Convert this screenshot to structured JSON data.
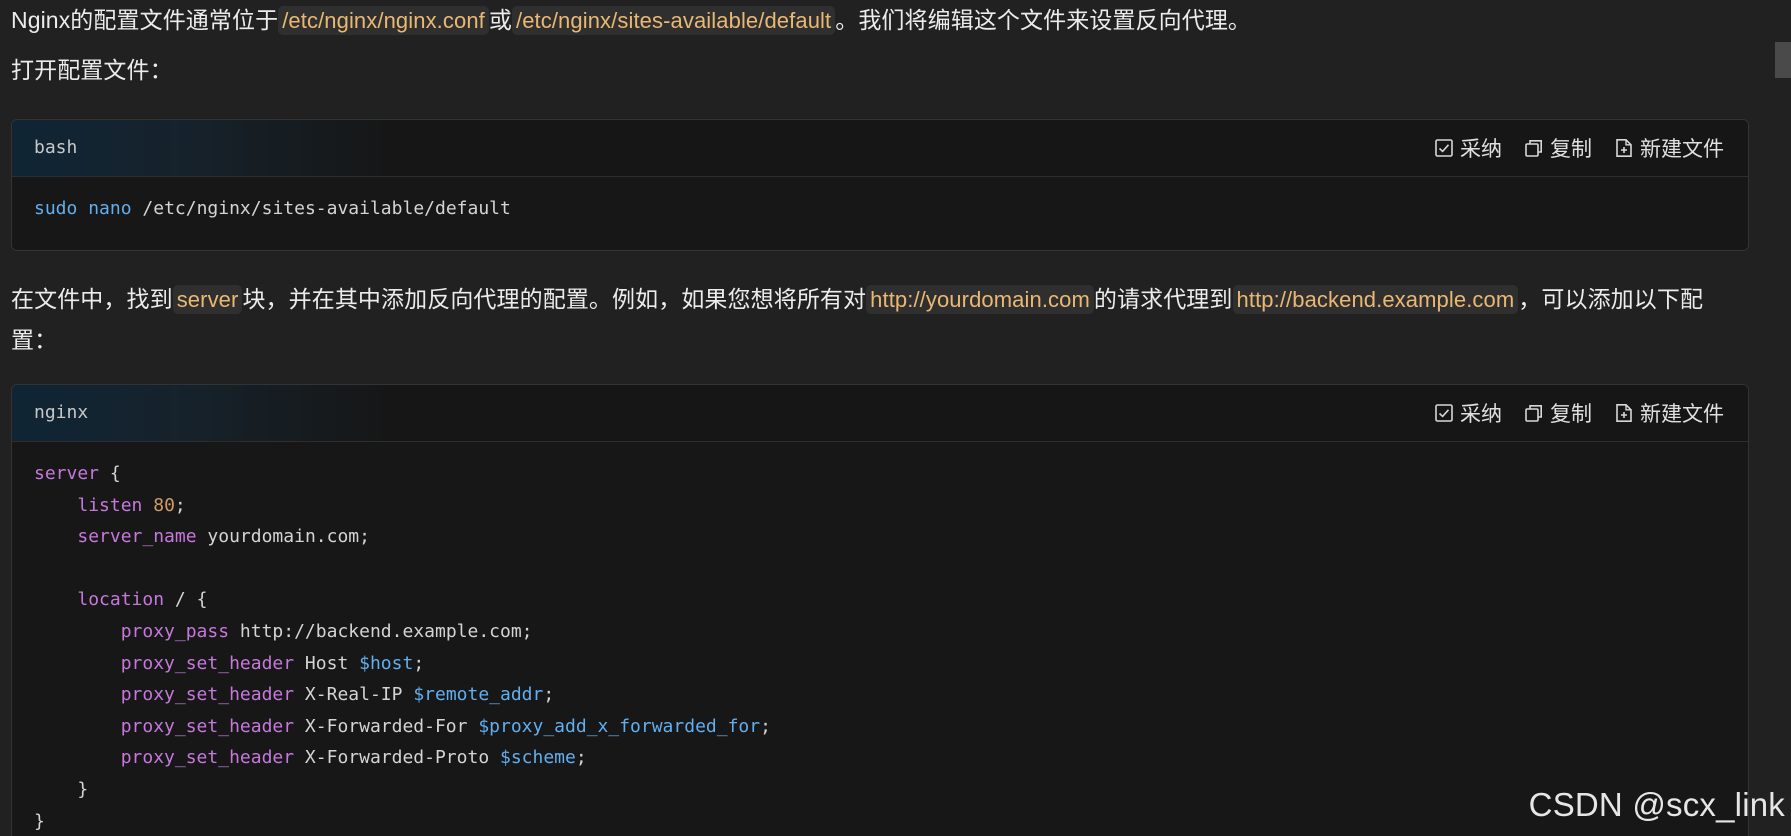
{
  "article": {
    "para1": {
      "t1": "Nginx的配置文件通常位于",
      "c1": "/etc/nginx/nginx.conf",
      "t2": "或",
      "c2": "/etc/nginx/sites-available/default",
      "t3": "。我们将编辑这个文件来设置反向代理。"
    },
    "para2": "打开配置文件：",
    "para3": {
      "t1": "在文件中，找到",
      "c1": "server",
      "t2": "块，并在其中添加反向代理的配置。例如，如果您想将所有对",
      "c2": "http://yourdomain.com",
      "t3": "的请求代理到",
      "c3": "http://backend.example.com",
      "t4": "，可以添加以下配置："
    }
  },
  "code_actions": {
    "adopt": "采纳",
    "copy": "复制",
    "new_file": "新建文件"
  },
  "block1": {
    "lang": "bash",
    "cmd": "sudo",
    "cmd2": "nano",
    "arg": " /etc/nginx/sites-available/default"
  },
  "block2": {
    "lang": "nginx",
    "server": "server",
    "open_brace": " {",
    "listen": "listen",
    "listen_val": "80",
    "semi": ";",
    "server_name": "server_name",
    "server_name_val": " yourdomain.com;",
    "location": "location",
    "location_val": " / {",
    "proxy_pass": "proxy_pass",
    "proxy_pass_val": " http://backend.example.com;",
    "psh": "proxy_set_header",
    "host_key": " Host ",
    "host_var": "$host",
    "realip_key": " X-Real-IP ",
    "realip_var": "$remote_addr",
    "xff_key": " X-Forwarded-For ",
    "xff_var": "$proxy_add_x_forwarded_for",
    "proto_key": " X-Forwarded-Proto ",
    "proto_var": "$scheme",
    "close_inner": "}",
    "close_outer": "}"
  },
  "watermark": "CSDN @scx_link",
  "colors": {
    "background": "#212121",
    "code_bg": "#171717",
    "inline_code": "#e9b872",
    "keyword": "#61afef",
    "directive": "#c678dd",
    "number": "#d19a66"
  },
  "icons": [
    "checkbox-icon",
    "copy-icon",
    "file-plus-icon"
  ]
}
